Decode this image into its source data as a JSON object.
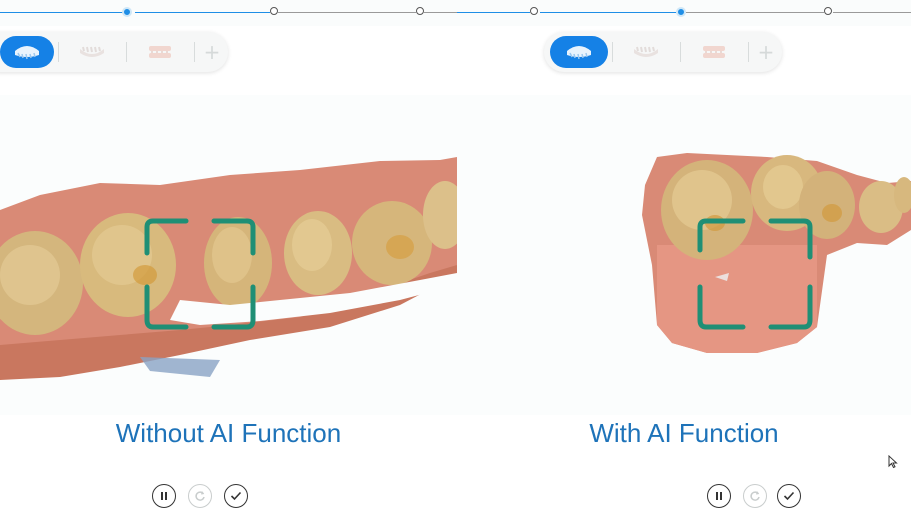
{
  "comparison": {
    "left": {
      "caption": "Without AI Function",
      "toolbar": {
        "items": [
          {
            "name": "upper-jaw",
            "icon": "upper-jaw-icon",
            "active": true
          },
          {
            "name": "lower-jaw",
            "icon": "lower-jaw-icon",
            "active": false
          },
          {
            "name": "bite",
            "icon": "bite-icon",
            "active": false
          },
          {
            "name": "add",
            "icon": "plus-icon",
            "active": false
          }
        ]
      },
      "controls": [
        {
          "name": "pause",
          "icon": "pause-icon",
          "enabled": true
        },
        {
          "name": "redo",
          "icon": "refresh-icon",
          "enabled": false
        },
        {
          "name": "confirm",
          "icon": "check-icon",
          "enabled": true
        }
      ]
    },
    "right": {
      "caption": "With AI Function",
      "toolbar": {
        "items": [
          {
            "name": "upper-jaw",
            "icon": "upper-jaw-icon",
            "active": true
          },
          {
            "name": "lower-jaw",
            "icon": "lower-jaw-icon",
            "active": false
          },
          {
            "name": "bite",
            "icon": "bite-icon",
            "active": false
          },
          {
            "name": "add",
            "icon": "plus-icon",
            "active": false
          }
        ]
      },
      "controls": [
        {
          "name": "pause",
          "icon": "pause-icon",
          "enabled": true
        },
        {
          "name": "redo",
          "icon": "refresh-icon",
          "enabled": false
        },
        {
          "name": "confirm",
          "icon": "check-icon",
          "enabled": true
        }
      ]
    }
  },
  "colors": {
    "accent": "#1581e6",
    "caption": "#1e73b9",
    "focus_frame": "#1f8f75",
    "gum": "#d98a76",
    "tooth": "#d6b77c"
  }
}
